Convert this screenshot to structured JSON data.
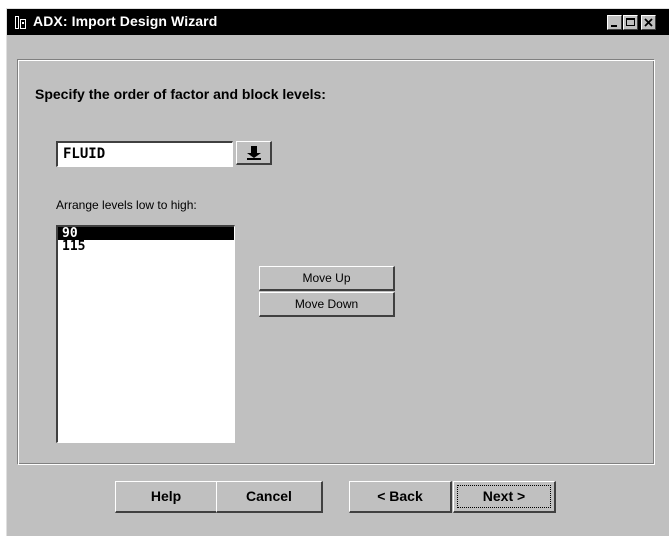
{
  "window": {
    "title": "ADX: Import Design Wizard",
    "app_icon": "adx-app-icon",
    "controls": [
      "minimize-icon",
      "maximize-icon",
      "close-icon"
    ]
  },
  "wizard": {
    "heading": "Specify the order of factor and block levels:",
    "factor_field": {
      "value": "FLUID",
      "dropdown_icon": "arrow-down-to-bar-icon"
    },
    "list_label": "Arrange levels low to high:",
    "levels": [
      "90",
      "115"
    ],
    "selected_level": "90",
    "move_up_label": "Move Up",
    "move_down_label": "Move Down"
  },
  "footer": {
    "help_label": "Help",
    "cancel_label": "Cancel",
    "back_label": "< Back",
    "next_label": "Next >"
  },
  "colors": {
    "face": "#c0c0c0",
    "titlebar": "#000000",
    "selection": "#000000"
  }
}
